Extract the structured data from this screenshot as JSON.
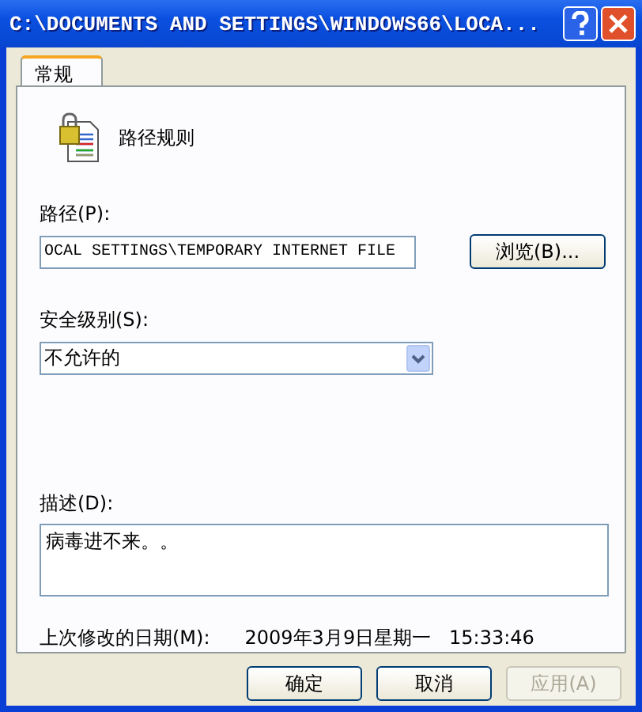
{
  "window": {
    "title": "C:\\DOCUMENTS AND SETTINGS\\WINDOWS66\\LOCA..."
  },
  "tabs": [
    {
      "label": "常规",
      "selected": true
    }
  ],
  "rule_name": "路径规则",
  "path": {
    "label": "路径(P):",
    "value": "OCAL SETTINGS\\TEMPORARY INTERNET FILE"
  },
  "browse_button": "浏览(B)...",
  "security_level": {
    "label": "安全级别(S):",
    "value": "不允许的"
  },
  "description": {
    "label": "描述(D):",
    "value": "病毒进不来。。"
  },
  "modified": {
    "label": "上次修改的日期(M):",
    "value": "2009年3月9日星期一   15:33:46"
  },
  "buttons": [
    {
      "label": "确定",
      "disabled": false
    },
    {
      "label": "取消",
      "disabled": false
    },
    {
      "label": "应用(A)",
      "disabled": true
    }
  ]
}
